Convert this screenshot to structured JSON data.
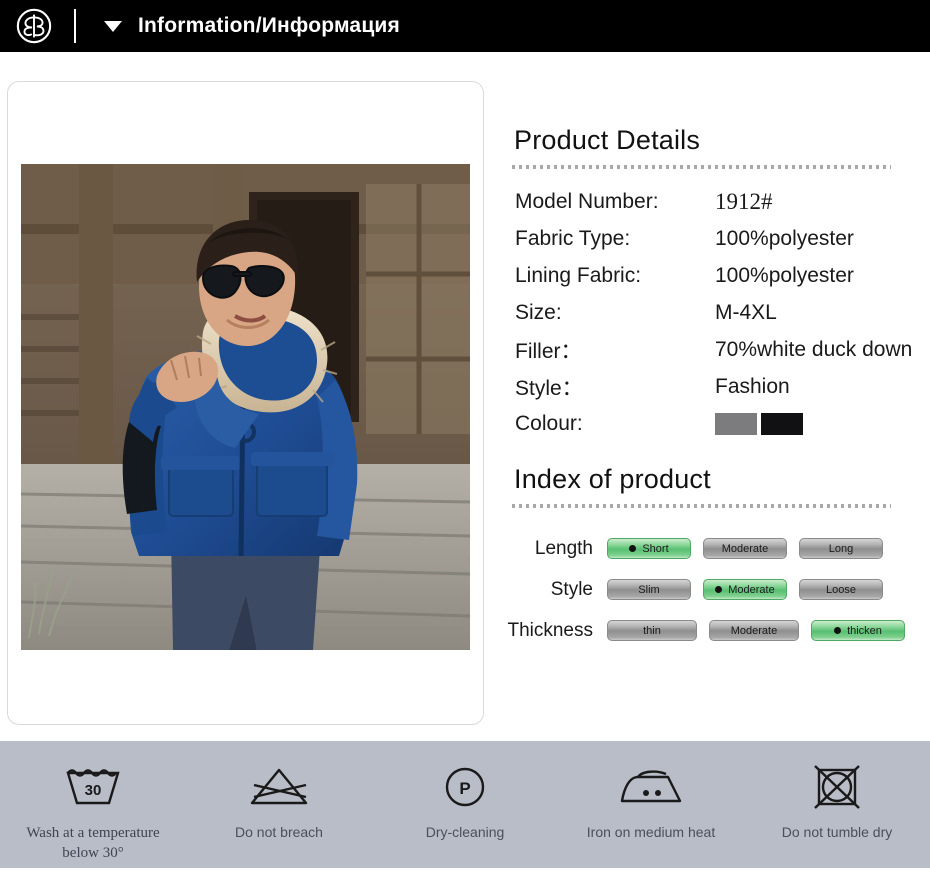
{
  "header": {
    "logo_icon": "brand-monogram-icon",
    "caret_icon": "triangle-down-icon",
    "title": "Information/Информация"
  },
  "photo": {
    "alt": "Man wearing blue fur-hooded down parka in front of a wooden building"
  },
  "product_details": {
    "heading": "Product Details",
    "rows": [
      {
        "label": "Model Number:",
        "value": "1912#",
        "style": "serif"
      },
      {
        "label": "Fabric  Type:",
        "value": "100%polyester",
        "style": "sans"
      },
      {
        "label": "Lining Fabric:",
        "value": "100%polyester",
        "style": "sans"
      },
      {
        "label": "Size:",
        "value": "M-4XL",
        "style": "sans"
      },
      {
        "label": "Filler：",
        "value": "70%white duck down",
        "style": "sans"
      },
      {
        "label": "Style：",
        "value": "Fashion",
        "style": "sans"
      },
      {
        "label": "Colour:",
        "value": "",
        "style": "swatches"
      }
    ],
    "colour_swatches": [
      {
        "name": "grey",
        "hex": "#7c7c7e"
      },
      {
        "name": "black",
        "hex": "#111113"
      }
    ]
  },
  "index_of_product": {
    "heading": "Index of product",
    "active_color": "#58c072",
    "inactive_color": "#8f8f8f",
    "rows": [
      {
        "label": "Length",
        "options": [
          {
            "text": "Short",
            "active": true
          },
          {
            "text": "Moderate",
            "active": false
          },
          {
            "text": "Long",
            "active": false
          }
        ]
      },
      {
        "label": "Style",
        "options": [
          {
            "text": "Slim",
            "active": false
          },
          {
            "text": "Moderate",
            "active": true
          },
          {
            "text": "Loose",
            "active": false
          }
        ]
      },
      {
        "label": "Thickness",
        "options": [
          {
            "text": "thin",
            "active": false
          },
          {
            "text": "Moderate",
            "active": false
          },
          {
            "text": "thicken",
            "active": true
          }
        ]
      }
    ]
  },
  "care_instructions": {
    "background": "#b9bdc8",
    "items": [
      {
        "icon": "wash-30-icon",
        "label": "Wash at a temperature\nbelow 30°",
        "serif": true,
        "temperature": "30"
      },
      {
        "icon": "do-not-bleach-icon",
        "label": "Do not breach",
        "serif": false
      },
      {
        "icon": "dry-cleaning-p-icon",
        "label": "Dry-cleaning",
        "serif": false,
        "symbol": "P"
      },
      {
        "icon": "iron-medium-heat-icon",
        "label": "Iron on medium heat",
        "serif": false
      },
      {
        "icon": "do-not-tumble-dry-icon",
        "label": "Do not tumble dry",
        "serif": false
      }
    ]
  }
}
